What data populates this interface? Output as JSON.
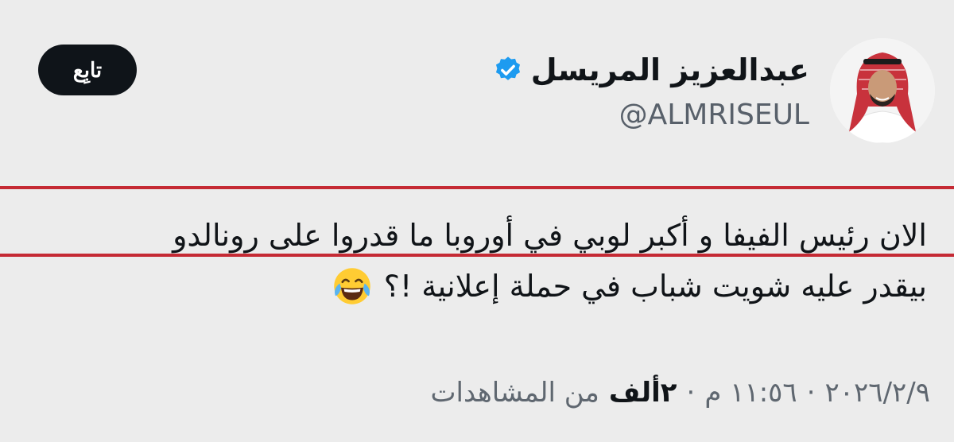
{
  "author": {
    "display_name": "عبدالعزيز المريسل",
    "handle": "@ALMRISEUL",
    "verified_icon": "verified-badge-icon",
    "avatar_icon": "avatar"
  },
  "actions": {
    "follow_label": "تابِع"
  },
  "tweet": {
    "line1": "الان رئيس الفيفا و أكبر لوبي في أوروبا ما قدروا على رونالدو",
    "line2": "بيقدر عليه شويت شباب في حملة إعلانية  !؟",
    "emoji": "face-with-tears-of-joy-icon"
  },
  "meta": {
    "date": "٢٠٢٦/٢/٩",
    "time": "١١:٥٦ م",
    "separator": "·",
    "views_count": "٢ألف",
    "views_label": "من المشاهدات"
  },
  "colors": {
    "background": "#ececec",
    "annotation_red": "#c52a34",
    "verified_blue": "#1d9bf0",
    "follow_bg": "#0f1419"
  }
}
